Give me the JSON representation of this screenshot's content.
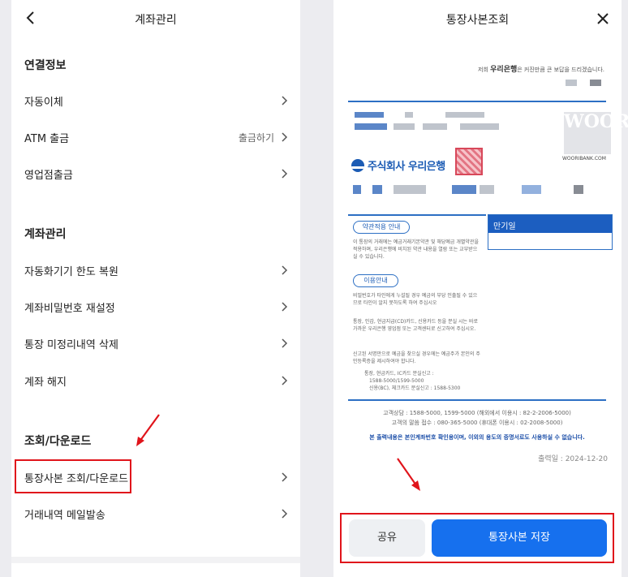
{
  "left": {
    "title": "계좌관리",
    "section_connect": "연결정보",
    "section_account": "계좌관리",
    "section_download": "조회/다운로드",
    "rows": {
      "autotransfer": "자동이체",
      "atm": "ATM 출금",
      "atm_aux": "출금하기",
      "branch": "영업점출금",
      "atm_limit": "자동화기기 한도 복원",
      "pw_reset": "계좌비밀번호 재설정",
      "unposted_delete": "통장 미정리내역 삭제",
      "close_account": "계좌 해지",
      "passbook_copy": "통장사본 조회/다운로드",
      "email_history": "거래내역 메일발송"
    }
  },
  "right": {
    "title": "통장사본조회",
    "tagline_prefix": "저희",
    "tagline_bank": "우리은행",
    "tagline_suffix": "은 커진만큼 큰 보답을 드리겠습니다.",
    "bank_name": "주식회사 우리은행",
    "woori_logo": "WOORi",
    "woori_url": "WOORIBANK.COM",
    "pill_terms": "약관적용 안내",
    "terms_text": "이 통장의 거래에는 예금거래기본약관 및 해당예금 개별약관을 적용하며, 우리은행에 비치된 약관 내용을 열람 또는 교부받으실 수 있습니다.",
    "pill_usage": "이용안내",
    "usage_1": "비밀번호가 타인에게 누설될 경우 예금의 부당 인출될 수 있으므로 타인이 알지 못하도록 하여 주십시오",
    "usage_2": "통장, 인감, 현금지급(CD)카드, 신용카드 등을 분실 시는 바로 가까운 우리은행 영업점 또는 고객센터로 신고하여 주십시오.",
    "usage_3": "신고된 서명만으로 예금을 찾으실 경우에는 예금주가 본인의 주민등록증을 제시하여야 합니다.",
    "usage_4a": "통장, 현금카드, IC카드 분실신고 :",
    "usage_4b": "1588-5000/1599-5000",
    "usage_4c": "신용(BC), 체크카드 분실신고 : 1588-5300",
    "maturity_label": "만기일",
    "contact_1": "고객상담 : 1588-5000, 1599-5000 (해외에서 이용시 : 82-2-2006-5000)",
    "contact_2": "고객의 말씀 접수 : 080-365-5000 (휴대폰 이용시 : 02-2008-5000)",
    "warning": "본 출력내용은 본인계좌번호 확인용이며, 이외의 용도의 증명서로도 사용하실 수 없습니다.",
    "print_date": "출력일 : 2024-12-20",
    "share_label": "공유",
    "save_label": "통장사본 저장"
  },
  "colors": {
    "accent": "#1670ee",
    "highlight": "#e0141b",
    "bank_blue": "#1b5bb4"
  }
}
